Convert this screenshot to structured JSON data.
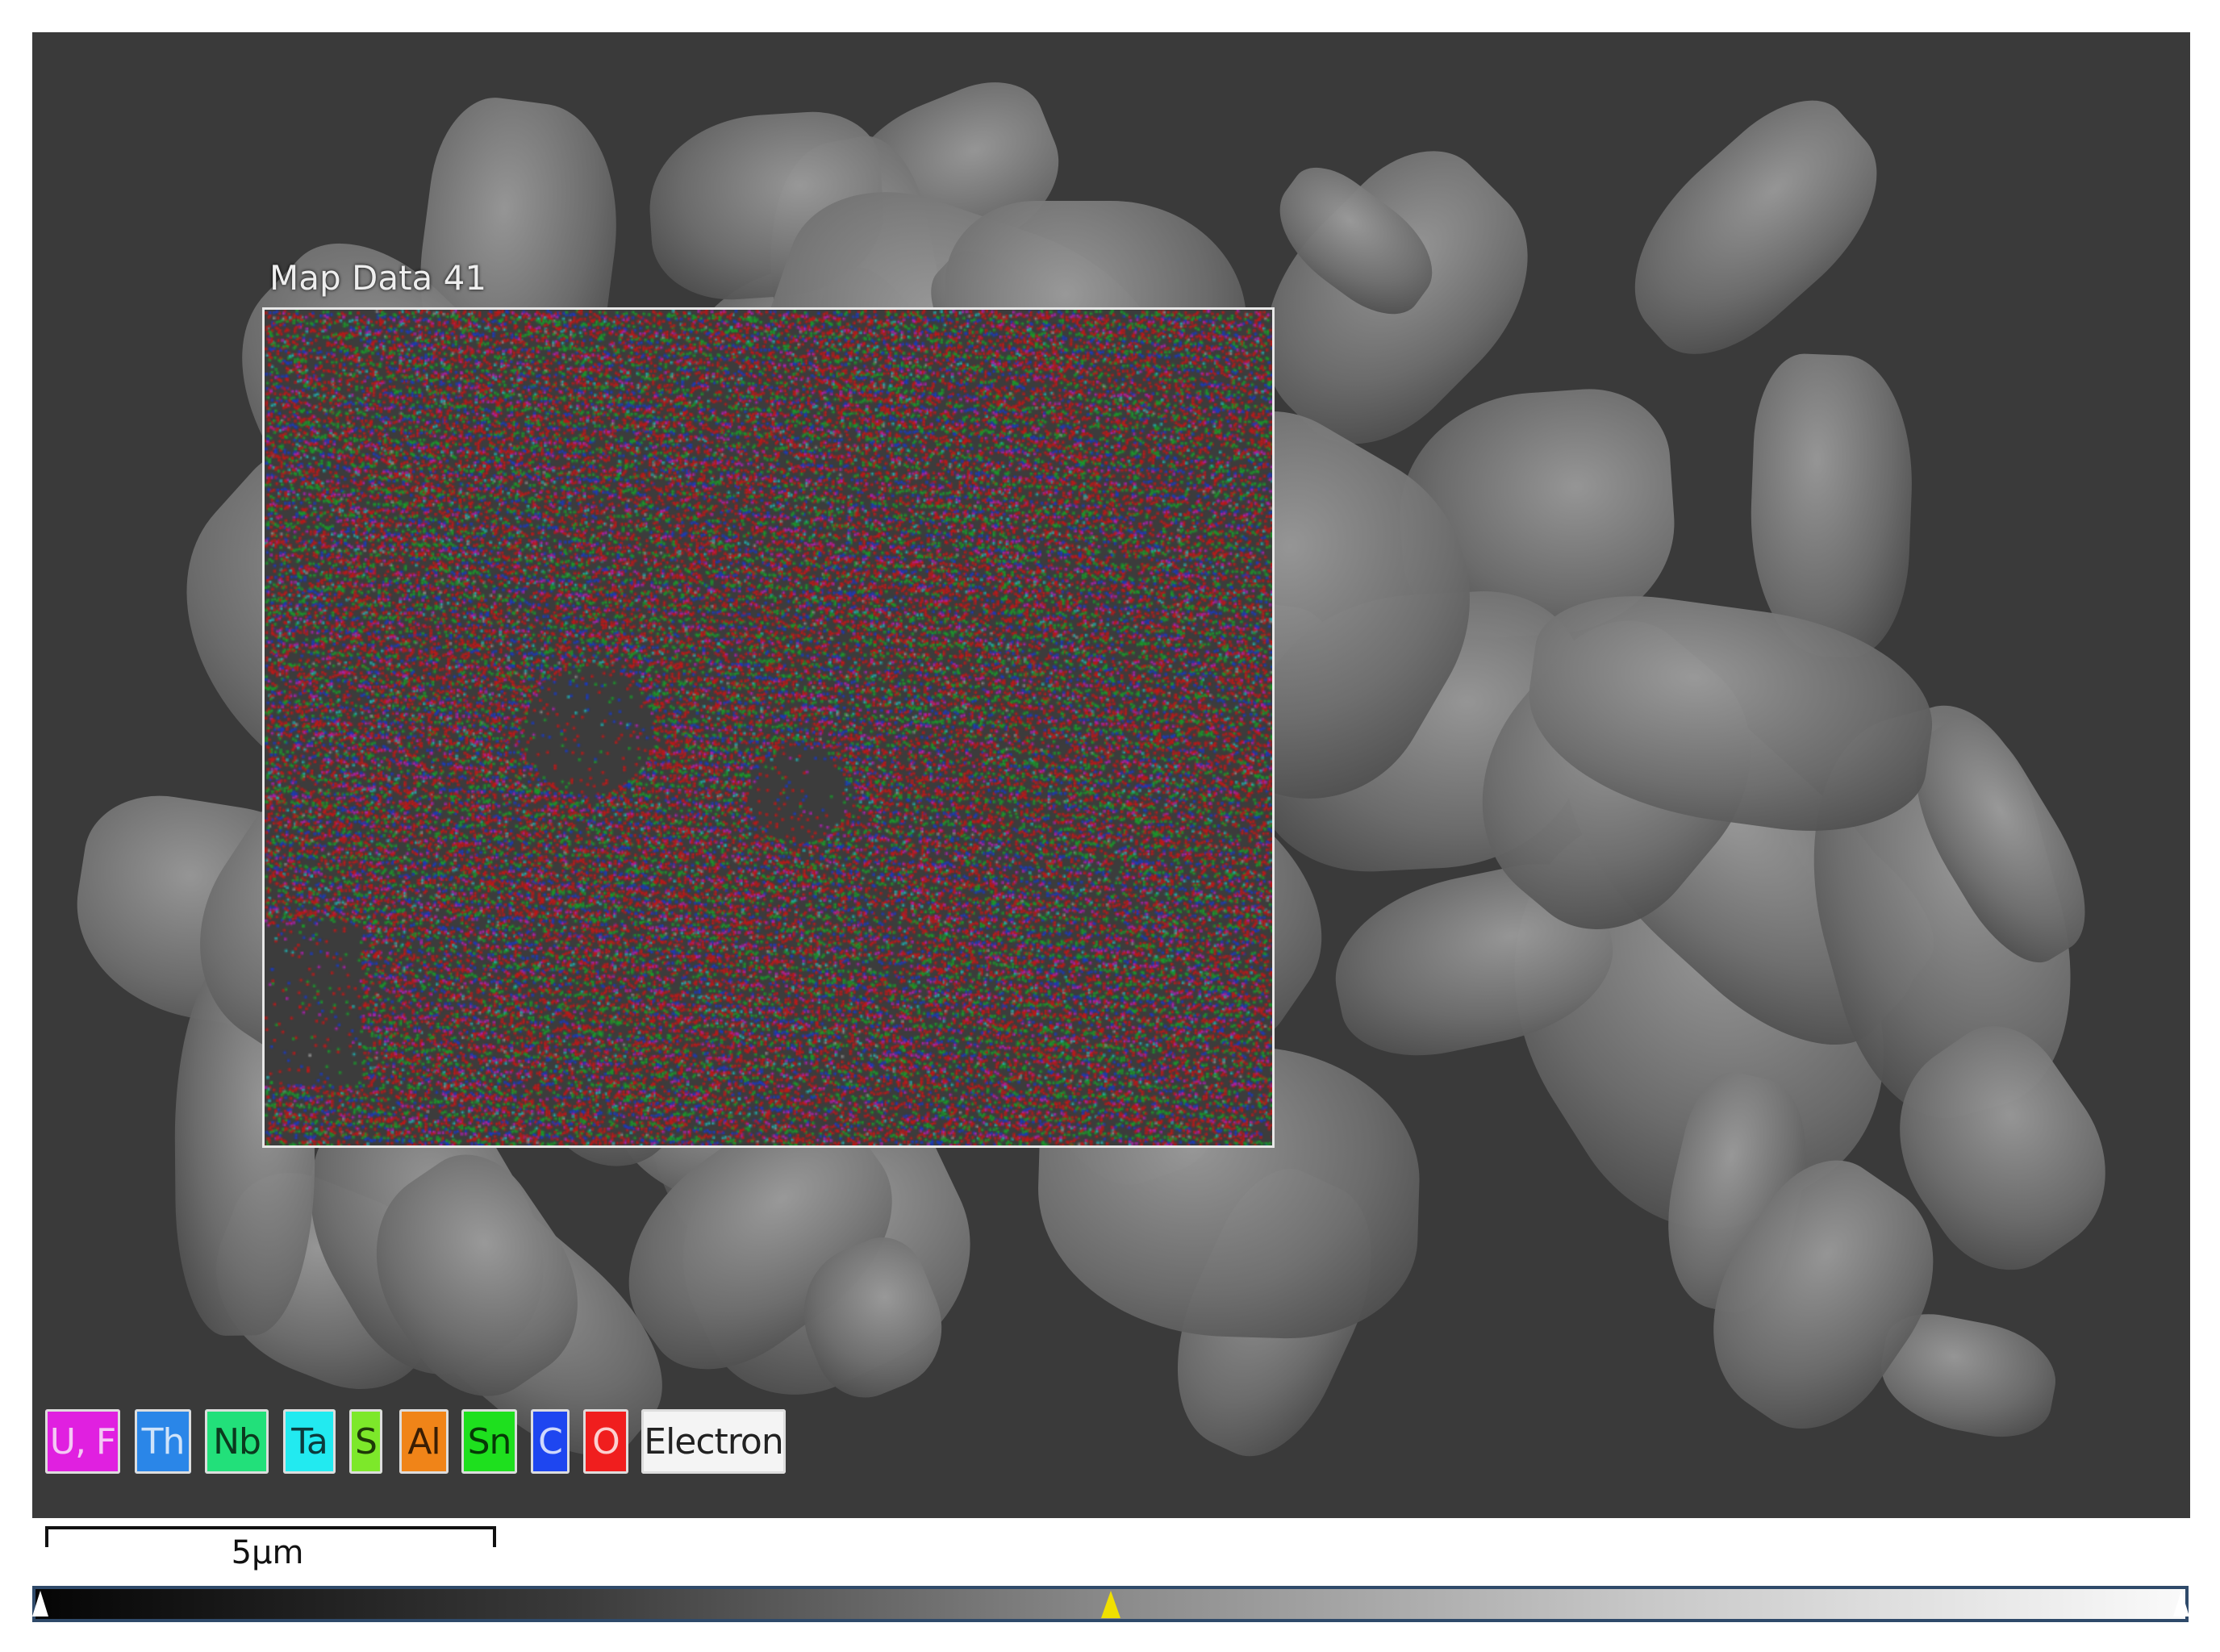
{
  "map": {
    "label": "Map Data 41"
  },
  "legend": [
    {
      "label": "U, F",
      "color": "#e020e0",
      "text_color": "#f4c8f4"
    },
    {
      "label": "Th",
      "color": "#2a86e8",
      "text_color": "#cfe3fa"
    },
    {
      "label": "Nb",
      "color": "#22e07a",
      "text_color": "#0b3a1e"
    },
    {
      "label": "Ta",
      "color": "#22eaf0",
      "text_color": "#0c3a3c"
    },
    {
      "label": "S",
      "color": "#7de82a",
      "text_color": "#1e3a08"
    },
    {
      "label": "Al",
      "color": "#f08418",
      "text_color": "#3a1e04"
    },
    {
      "label": "Sn",
      "color": "#1ee01e",
      "text_color": "#063a06"
    },
    {
      "label": "C",
      "color": "#1e46f0",
      "text_color": "#cfd8fc"
    },
    {
      "label": "O",
      "color": "#f01e1e",
      "text_color": "#fcd0d0"
    },
    {
      "label": "Electron",
      "color": "#f4f4f4",
      "text_color": "#222222"
    }
  ],
  "scale_bar": {
    "label": "5µm"
  },
  "color_bar": {
    "marker_position": 0.5,
    "marker_color": "#f0e000"
  }
}
